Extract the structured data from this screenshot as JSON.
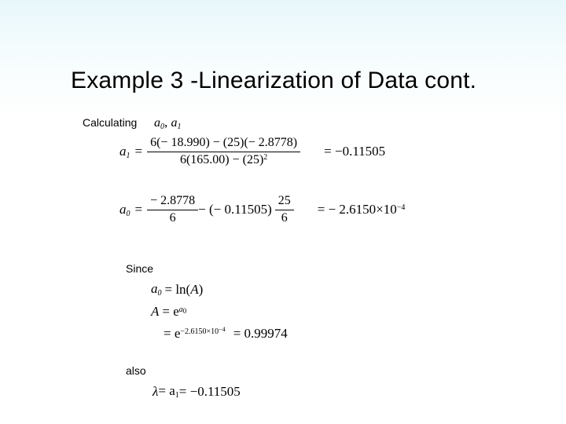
{
  "title": "Example 3 -Linearization of Data cont.",
  "labels": {
    "calculating": "Calculating",
    "since": "Since",
    "also": "also"
  },
  "calc_vars": {
    "a0": "a",
    "a0_sub": "0",
    "sep": ", ",
    "a1": "a",
    "a1_sub": "1"
  },
  "a1": {
    "lhs_sym": "a",
    "lhs_sub": "1",
    "num": "6(− 18.990) − (25)(− 2.8778)",
    "den_left": "6(165.00) − (25)",
    "den_sup": "2",
    "rhs": "= −0.11505"
  },
  "a0": {
    "lhs_sym": "a",
    "lhs_sub": "0",
    "f1_num": "− 2.8778",
    "f1_den": "6",
    "mid": " − (− 0.11505)",
    "f2_num": "25",
    "f2_den": "6",
    "rhs_a": "= − 2.6150",
    "rhs_b": "×10",
    "rhs_exp": "−4"
  },
  "since": {
    "l1_lhs": "a",
    "l1_sub": "0",
    "l1_rhs_a": "= ln(",
    "l1_rhs_b": "A",
    "l1_rhs_c": ")",
    "l2_lhs": "A",
    "l2_rhs": "= e",
    "l2_exp_a": "a",
    "l2_exp_b": "0",
    "l3_rhs": "= e",
    "l3_exp_a": "−2.6150×10",
    "l3_exp_b": "−4",
    "l3_val": "= 0.99974"
  },
  "also_line": {
    "lambda": "λ",
    "mid": " = a",
    "sub": "1",
    "rhs": " = −0.11505"
  }
}
